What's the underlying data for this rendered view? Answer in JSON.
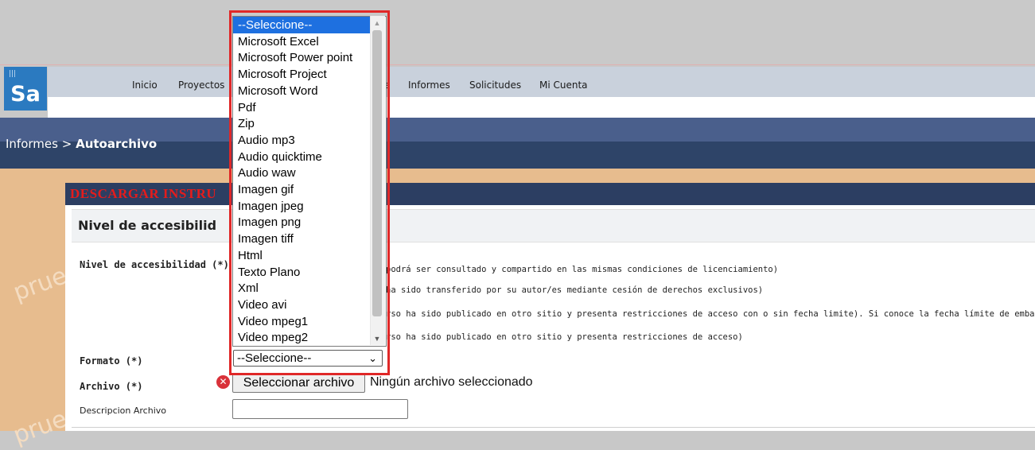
{
  "logo": {
    "text": "Sa"
  },
  "nav": {
    "items": [
      "Inicio",
      "Proyectos",
      "s",
      "Informes",
      "Solicitudes",
      "Mi Cuenta"
    ]
  },
  "breadcrumb": {
    "parent": "Informes",
    "separator": ">",
    "current": "Autoarchivo"
  },
  "banner": {
    "text": "DESCARGAR INSTRU"
  },
  "section": {
    "title": "Nivel de accesibilid"
  },
  "form": {
    "nivel_label": "Nivel de accesibilidad (*)",
    "nivel_options": [
      "podrá ser consultado y compartido en las mismas condiciones de licenciamiento)",
      "ha sido transferido por su autor/es mediante cesión de derechos exclusivos)",
      "rso ha sido publicado en otro sitio y presenta restricciones de acceso con o sin fecha limite). Si conoce la fecha límite de emba",
      "rso ha sido publicado en otro sitio y presenta restricciones de acceso)"
    ],
    "formato_label": "Formato (*)",
    "formato_selected": "--Seleccione--",
    "archivo_label": "Archivo (*)",
    "file_button": "Seleccionar archivo",
    "file_status": "Ningún archivo seleccionado",
    "descripcion_label": "Descripcion Archivo",
    "descripcion_value": ""
  },
  "dropdown": {
    "options": [
      "--Seleccione--",
      "Microsoft Excel",
      "Microsoft Power point",
      "Microsoft Project",
      "Microsoft Word",
      "Pdf",
      "Zip",
      "Audio mp3",
      "Audio quicktime",
      "Audio waw",
      "Imagen gif",
      "Imagen jpeg",
      "Imagen png",
      "Imagen tiff",
      "Html",
      "Texto Plano",
      "Xml",
      "Video avi",
      "Video mpeg1",
      "Video mpeg2"
    ],
    "highlighted": "--Seleccione--"
  },
  "watermark": {
    "text": "prue"
  },
  "colors": {
    "highlight": "#1e70e0",
    "frame": "#e02828",
    "banner_text": "#e41c1c",
    "nav_dark": "#2e4468"
  }
}
